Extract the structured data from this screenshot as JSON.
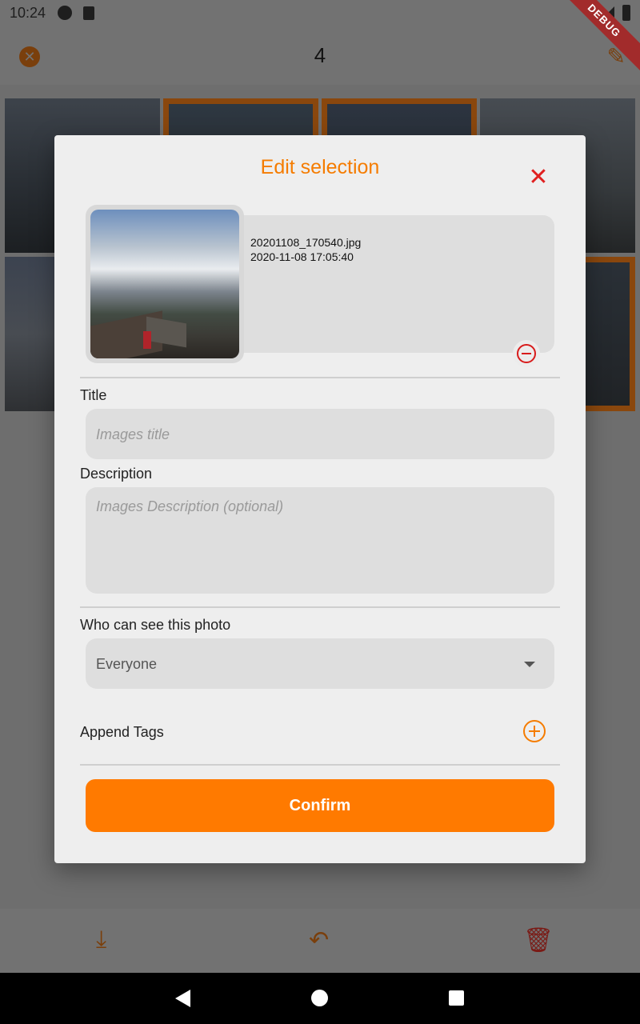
{
  "status_bar": {
    "time": "10:24",
    "debug_label": "DEBUG"
  },
  "app_bar": {
    "selection_count": "4"
  },
  "dialog": {
    "title": "Edit selection",
    "file": {
      "name": "20201108_170540.jpg",
      "datetime": "2020-11-08 17:05:40"
    },
    "title_field": {
      "label": "Title",
      "placeholder": "Images title"
    },
    "description_field": {
      "label": "Description",
      "placeholder": "Images Description (optional)"
    },
    "visibility": {
      "label": "Who can see this photo",
      "selected": "Everyone"
    },
    "tags": {
      "label": "Append Tags"
    },
    "confirm_label": "Confirm"
  },
  "icons": {
    "close": "close-icon",
    "edit": "pencil-icon",
    "download": "download-icon",
    "reply": "reply-icon",
    "delete": "trash-icon",
    "remove": "remove-circle-icon",
    "add": "add-circle-icon"
  },
  "colors": {
    "accent": "#ff7a00",
    "danger": "#e02020"
  }
}
